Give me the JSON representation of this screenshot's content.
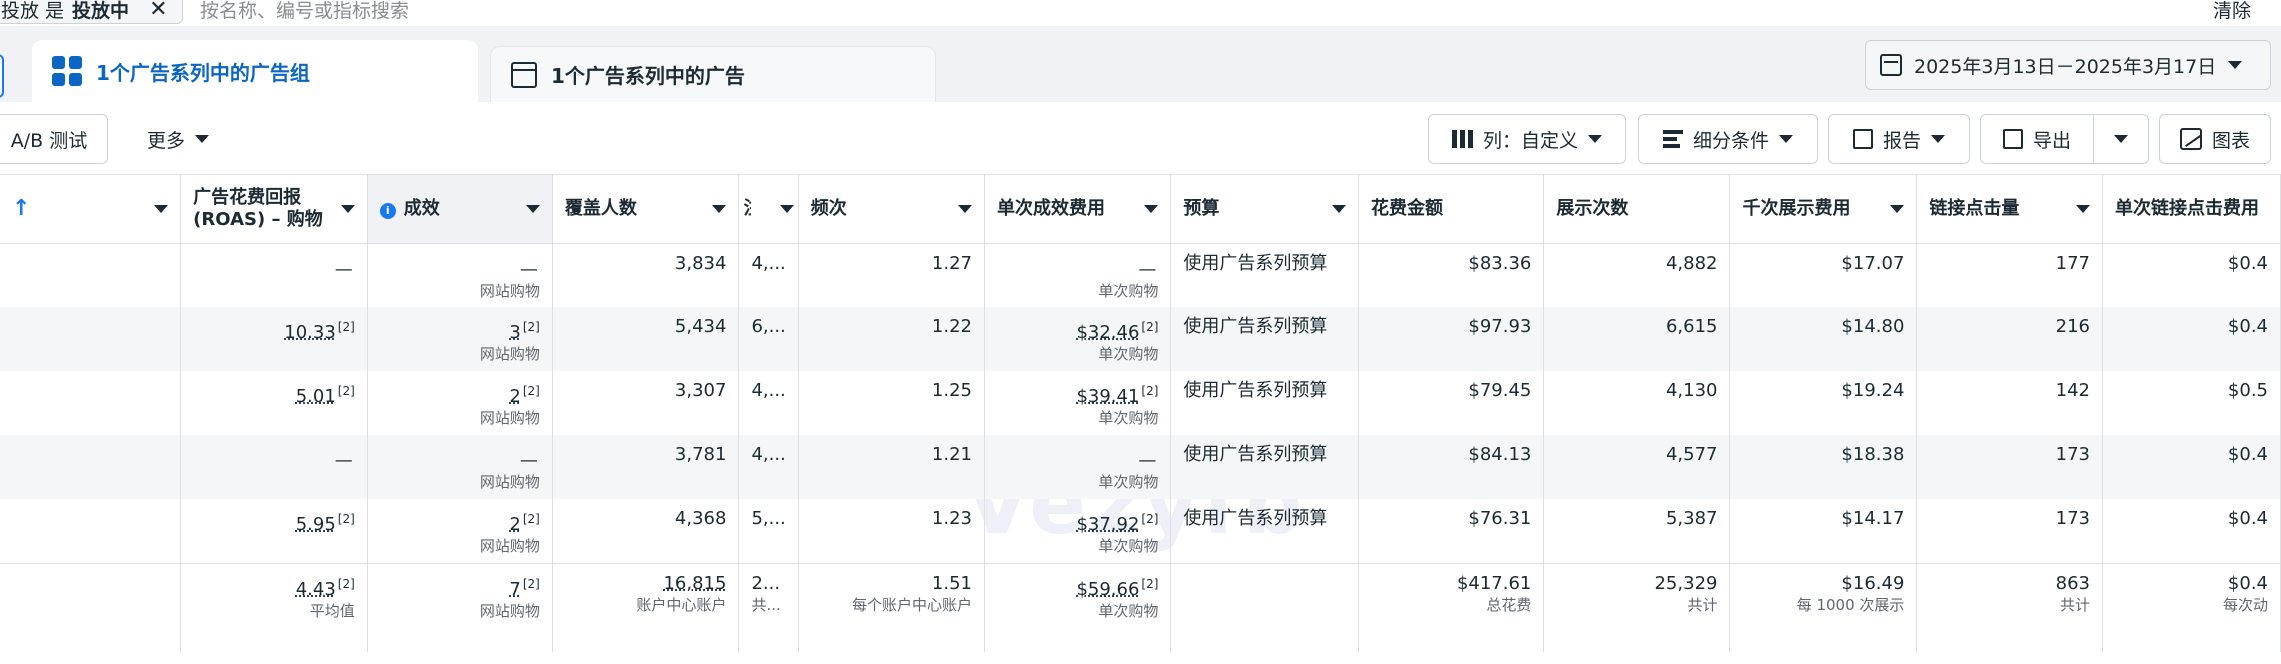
{
  "filter": {
    "prefix": "投放 是",
    "value": "投放中",
    "close": "✕",
    "search_placeholder": "按名称、编号或指标搜索",
    "clear": "清除"
  },
  "tabs": [
    {
      "label": "1个广告系列中的广告组"
    },
    {
      "label": "1个广告系列中的广告"
    }
  ],
  "date_range": "2025年3月13日－2025年3月17日",
  "toolbar": {
    "ab_test": "A/B 测试",
    "more": "更多",
    "columns": "列：自定义",
    "breakdown": "细分条件",
    "reports": "报告",
    "export": "导出",
    "charts": "图表"
  },
  "columns": [
    {
      "label": ""
    },
    {
      "label": "广告花费回报 (ROAS) – 购物"
    },
    {
      "label": "成效"
    },
    {
      "label": "覆盖人数"
    },
    {
      "label": "注"
    },
    {
      "label": "频次"
    },
    {
      "label": "单次成效费用"
    },
    {
      "label": "预算"
    },
    {
      "label": "花费金额"
    },
    {
      "label": "展示次数"
    },
    {
      "label": "千次展示费用"
    },
    {
      "label": "链接点击量"
    },
    {
      "label": "单次链接点击费用"
    }
  ],
  "rows": [
    {
      "roas": "—",
      "roas_fn": "",
      "results": "—",
      "results_fn": "",
      "results_sub": "网站购物",
      "reach": "3,834",
      "impr_trunc": "4,...",
      "frequency": "1.27",
      "cpr": "—",
      "cpr_fn": "",
      "cpr_sub": "单次购物",
      "budget": "使用广告系列预算",
      "spend": "$83.36",
      "impressions": "4,882",
      "cpm": "$17.07",
      "clicks": "177",
      "cpc": "$0.4"
    },
    {
      "roas": "10.33",
      "roas_fn": "[2]",
      "results": "3",
      "results_fn": "[2]",
      "results_sub": "网站购物",
      "reach": "5,434",
      "impr_trunc": "6,...",
      "frequency": "1.22",
      "cpr": "$32.46",
      "cpr_fn": "[2]",
      "cpr_sub": "单次购物",
      "budget": "使用广告系列预算",
      "spend": "$97.93",
      "impressions": "6,615",
      "cpm": "$14.80",
      "clicks": "216",
      "cpc": "$0.4"
    },
    {
      "roas": "5.01",
      "roas_fn": "[2]",
      "results": "2",
      "results_fn": "[2]",
      "results_sub": "网站购物",
      "reach": "3,307",
      "impr_trunc": "4,...",
      "frequency": "1.25",
      "cpr": "$39.41",
      "cpr_fn": "[2]",
      "cpr_sub": "单次购物",
      "budget": "使用广告系列预算",
      "spend": "$79.45",
      "impressions": "4,130",
      "cpm": "$19.24",
      "clicks": "142",
      "cpc": "$0.5"
    },
    {
      "roas": "—",
      "roas_fn": "",
      "results": "—",
      "results_fn": "",
      "results_sub": "网站购物",
      "reach": "3,781",
      "impr_trunc": "4,...",
      "frequency": "1.21",
      "cpr": "—",
      "cpr_fn": "",
      "cpr_sub": "单次购物",
      "budget": "使用广告系列预算",
      "spend": "$84.13",
      "impressions": "4,577",
      "cpm": "$18.38",
      "clicks": "173",
      "cpc": "$0.4"
    },
    {
      "roas": "5.95",
      "roas_fn": "[2]",
      "results": "2",
      "results_fn": "[2]",
      "results_sub": "网站购物",
      "reach": "4,368",
      "impr_trunc": "5,...",
      "frequency": "1.23",
      "cpr": "$37.92",
      "cpr_fn": "[2]",
      "cpr_sub": "单次购物",
      "budget": "使用广告系列预算",
      "spend": "$76.31",
      "impressions": "5,387",
      "cpm": "$14.17",
      "clicks": "173",
      "cpc": "$0.4"
    }
  ],
  "summary": {
    "roas": "4.43",
    "roas_fn": "[2]",
    "roas_sub": "平均值",
    "results": "7",
    "results_fn": "[2]",
    "results_sub": "网站购物",
    "reach": "16,815",
    "reach_sub": "账户中心账户",
    "impr_trunc": "2...",
    "impr_trunc_sub": "共...",
    "frequency": "1.51",
    "frequency_sub": "每个账户中心账户",
    "cpr": "$59.66",
    "cpr_fn": "[2]",
    "cpr_sub": "单次购物",
    "spend": "$417.61",
    "spend_sub": "总花费",
    "impressions": "25,329",
    "impressions_sub": "共计",
    "cpm": "$16.49",
    "cpm_sub": "每 1000 次展示",
    "clicks": "863",
    "clicks_sub": "共计",
    "cpc": "$0.4",
    "cpc_sub": "每次动"
  },
  "watermark": "Vezyfb"
}
